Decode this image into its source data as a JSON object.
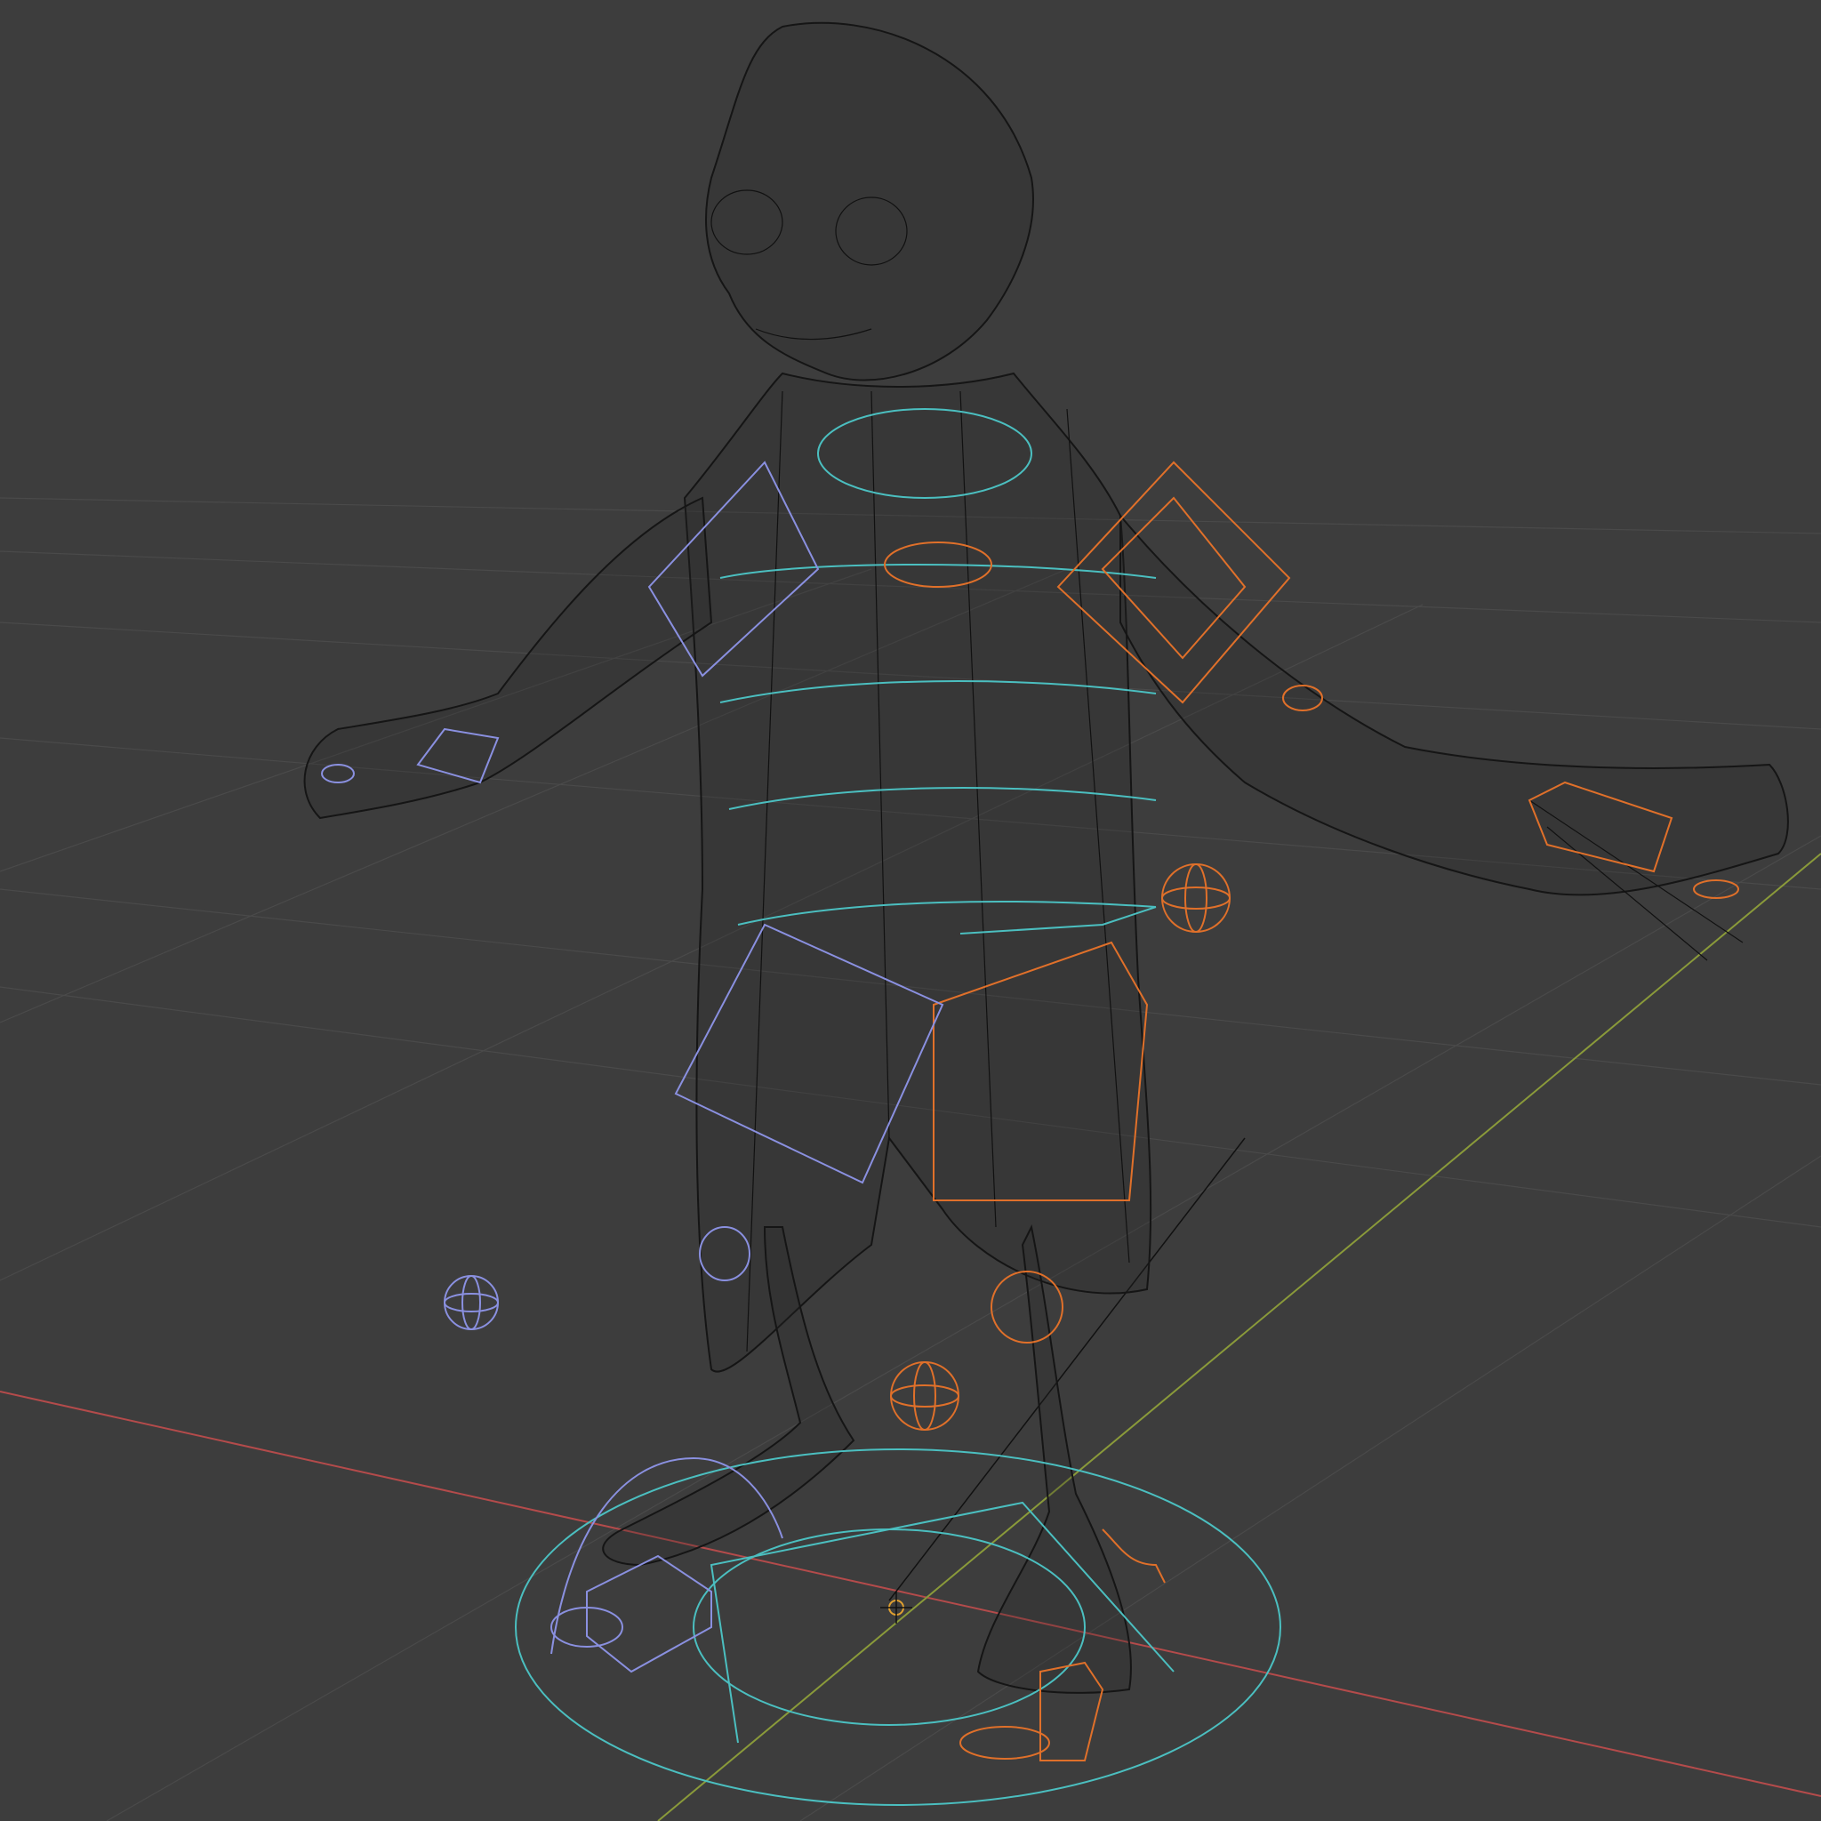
{
  "viewport": {
    "mode": "wireframe",
    "background_color": "#3d3d3d",
    "grid_color": "#4a4a4a",
    "axis_x_color": "#b44b4b",
    "axis_y_color": "#8a9a3a",
    "mesh_color": "#111111",
    "controls": {
      "cyan": "#4bbfc0",
      "orange": "#e0702a",
      "blue": "#8a90e0"
    },
    "icons": [
      "origin-cursor-icon",
      "sphere-control-icon",
      "cube-control-icon"
    ]
  }
}
